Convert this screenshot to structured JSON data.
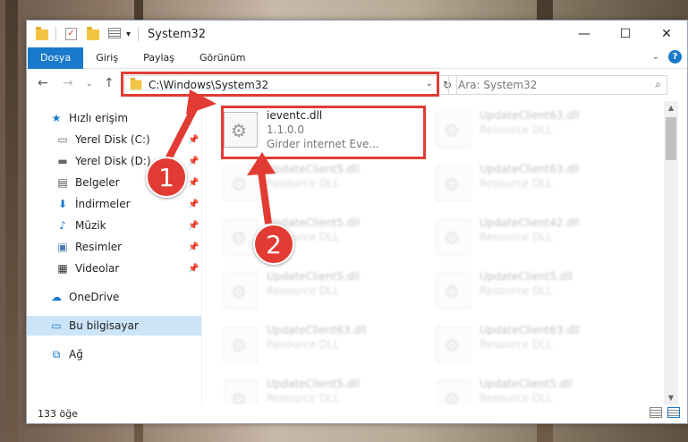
{
  "window": {
    "title": "System32",
    "controls": {
      "minimize": "—",
      "maximize": "☐",
      "close": "✕"
    }
  },
  "ribbon": {
    "tabs": [
      "Dosya",
      "Giriş",
      "Paylaş",
      "Görünüm"
    ],
    "active_tab": "Dosya",
    "help": "?"
  },
  "address_bar": {
    "path": "C:\\Windows\\System32",
    "search_placeholder": "Ara: System32"
  },
  "sidebar": {
    "items": [
      {
        "label": "Hızlı erişim",
        "icon": "star-icon",
        "pinned": false
      },
      {
        "label": "Yerel Disk (C:)",
        "icon": "drive-icon",
        "pinned": true
      },
      {
        "label": "Yerel Disk (D:)",
        "icon": "drive-icon",
        "pinned": true
      },
      {
        "label": "Belgeler",
        "icon": "documents-icon",
        "pinned": true
      },
      {
        "label": "İndirmeler",
        "icon": "download-icon",
        "pinned": true
      },
      {
        "label": "Müzik",
        "icon": "music-icon",
        "pinned": true
      },
      {
        "label": "Resimler",
        "icon": "pictures-icon",
        "pinned": true
      },
      {
        "label": "Videolar",
        "icon": "videos-icon",
        "pinned": true
      },
      {
        "label": "OneDrive",
        "icon": "cloud-icon",
        "pinned": false
      },
      {
        "label": "Bu bilgisayar",
        "icon": "computer-icon",
        "pinned": false,
        "selected": true
      },
      {
        "label": "Ağ",
        "icon": "network-icon",
        "pinned": false
      }
    ]
  },
  "files": {
    "highlighted": {
      "name": "ieventc.dll",
      "version": "1.1.0.0",
      "description": "Girder internet Eve..."
    },
    "others": [
      {
        "name": "UpdateClient63.dll",
        "description": "Resource DLL"
      },
      {
        "name": "UpdateClient5.dll",
        "description": "Resource DLL"
      },
      {
        "name": "UpdateClient63.dll",
        "description": "Resource DLL"
      },
      {
        "name": "UpdateClient5.dll",
        "description": "Resource DLL"
      },
      {
        "name": "UpdateClient42.dll",
        "description": "Resource DLL"
      },
      {
        "name": "UpdateClient5.dll",
        "description": "Resource DLL"
      },
      {
        "name": "UpdateClient5.dll",
        "description": "Resource DLL"
      },
      {
        "name": "UpdateClient63.dll",
        "description": "Resource DLL"
      },
      {
        "name": "UpdateClient63.dll",
        "description": "Resource DLL"
      },
      {
        "name": "UpdateClient5.dll",
        "description": "Resource DLL"
      },
      {
        "name": "UpdateClient5.dll",
        "description": "Resource DLL"
      }
    ]
  },
  "status": {
    "item_count": "133 öğe"
  },
  "annotations": {
    "step1": "1",
    "step2": "2",
    "color": "#e23b33"
  }
}
